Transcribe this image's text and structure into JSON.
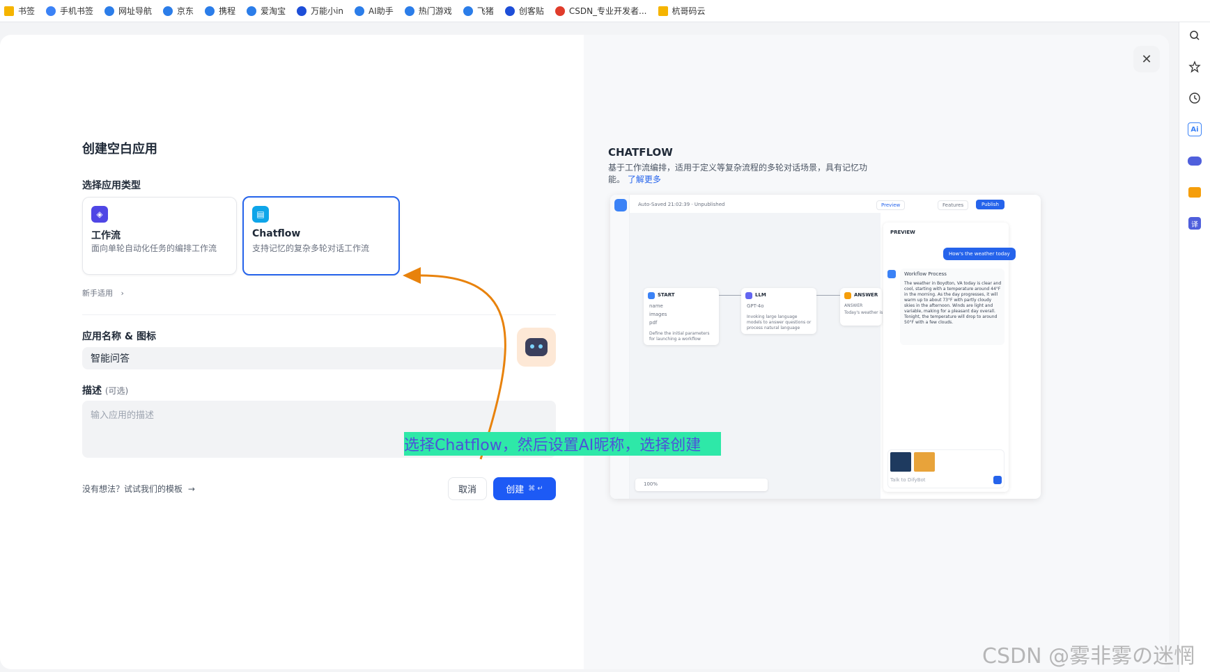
{
  "bookmarks": [
    {
      "label": "书签",
      "color": "#f5b400"
    },
    {
      "label": "手机书签",
      "color": "#3b82f6"
    },
    {
      "label": "网址导航",
      "color": "#2b7de9"
    },
    {
      "label": "京东",
      "color": "#2b7de9"
    },
    {
      "label": "携程",
      "color": "#2b7de9"
    },
    {
      "label": "爱淘宝",
      "color": "#2b7de9"
    },
    {
      "label": "万能小in",
      "color": "#1d4ed8"
    },
    {
      "label": "AI助手",
      "color": "#2b7de9"
    },
    {
      "label": "热门游戏",
      "color": "#2b7de9"
    },
    {
      "label": "飞猪",
      "color": "#2b7de9"
    },
    {
      "label": "创客贴",
      "color": "#1d4ed8"
    },
    {
      "label": "CSDN_专业开发者...",
      "color": "#e03c2b"
    },
    {
      "label": "杭哥码云",
      "color": "#f5b400"
    }
  ],
  "modal": {
    "title": "创建空白应用",
    "type_label": "选择应用类型",
    "cards": [
      {
        "title": "工作流",
        "desc": "面向单轮自动化任务的编排工作流",
        "icon_color": "#4f46e5",
        "selected": false
      },
      {
        "title": "Chatflow",
        "desc": "支持记忆的复杂多轮对话工作流",
        "icon_color": "#0ea5e9",
        "selected": true
      }
    ],
    "beginner_link": "新手适用",
    "name_label": "应用名称 & 图标",
    "name_value": "智能问答",
    "desc_label": "描述",
    "desc_optional": "(可选)",
    "desc_placeholder": "输入应用的描述",
    "template_link": "没有想法？试试我们的模板",
    "cancel_label": "取消",
    "create_label": "创建",
    "create_shortcut": "⌘ ↵",
    "close_icon": "close-icon"
  },
  "annotation": {
    "text": "选择Chatflow，然后设置AI昵称，选择创建",
    "arrow_color": "#e8820c"
  },
  "right_panel": {
    "title": "CHATFLOW",
    "desc": "基于工作流编排，适用于定义等复杂流程的多轮对话场景，具有记忆功能。",
    "learn_more": "了解更多"
  },
  "preview": {
    "autosave": "Auto-Saved 21:02:39 · Unpublished",
    "preview_btn": "Preview",
    "features_btn": "Features",
    "publish_btn": "Publish",
    "panel_title": "PREVIEW",
    "user_msg": "How's the weather today",
    "workflow_process": "Workflow Process",
    "answer_text": "The weather in Boydton, VA today is clear and cool, starting with a temperature around 44°F in the morning. As the day progresses, it will warm up to about 73°F with partly cloudy skies in the afternoon. Winds are light and variable, making for a pleasant day overall. Tonight, the temperature will drop to around 50°F with a few clouds.",
    "input_placeholder": "Talk to DifyBot",
    "zoom": "100%",
    "nodes": [
      {
        "title": "START",
        "lines": [
          "name",
          "images",
          "pdf"
        ],
        "note": "Define the initial parameters for launching a workflow"
      },
      {
        "title": "LLM",
        "lines": [
          "GPT-4o"
        ],
        "note": "Invoking large language models to answer questions or process natural language"
      },
      {
        "title": "ANSWER",
        "lines": [
          "ANSWER",
          "Today's weather is {{x}}"
        ],
        "note": ""
      }
    ]
  },
  "watermark": "CSDN @雾非雾の迷惘"
}
